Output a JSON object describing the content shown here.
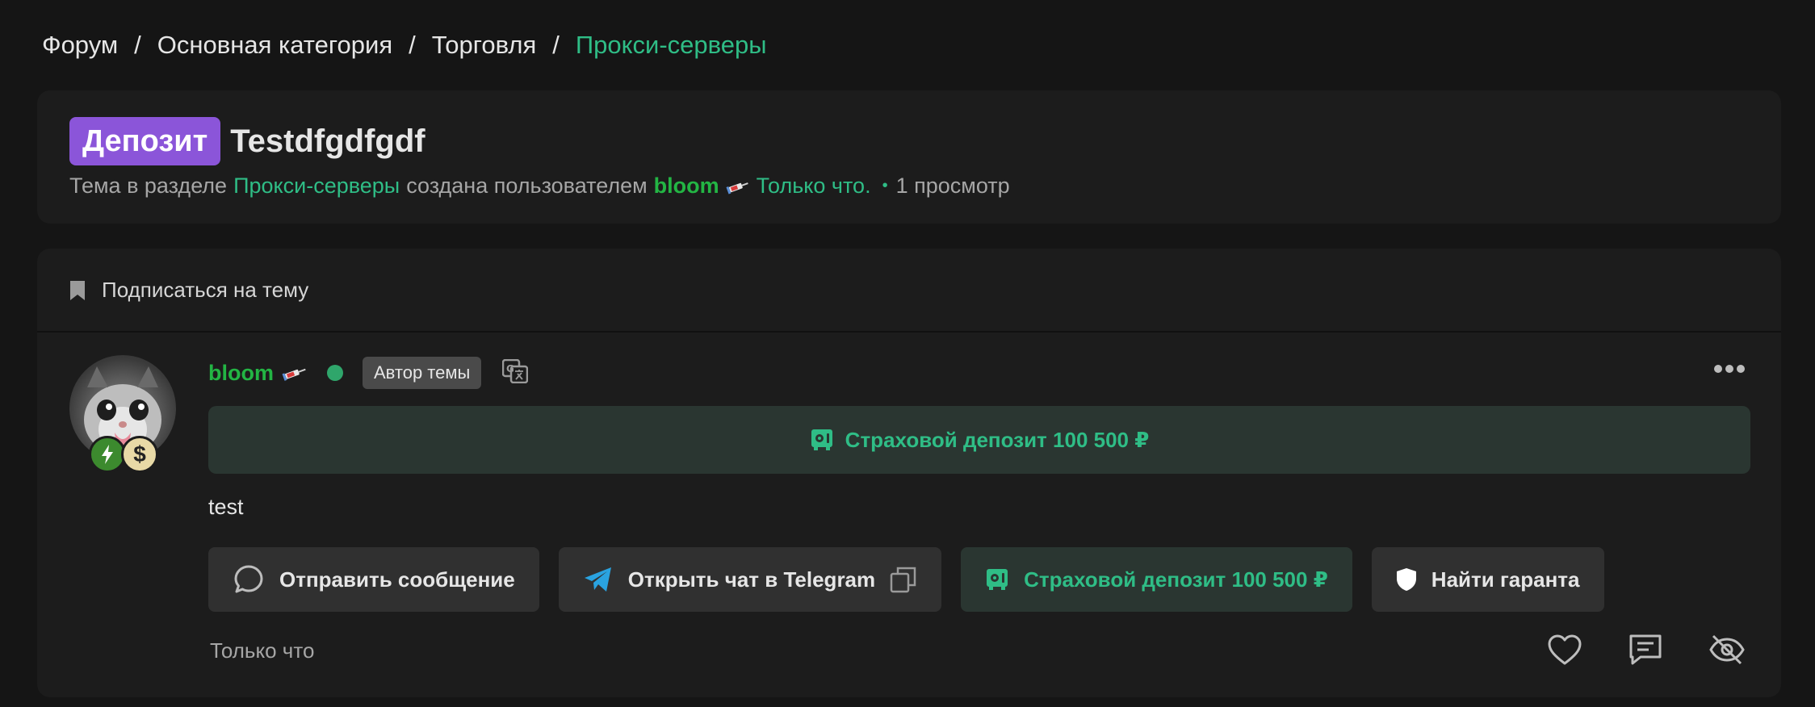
{
  "breadcrumb": {
    "items": [
      "Форум",
      "Основная категория",
      "Торговля",
      "Прокси-серверы"
    ],
    "separator": "/"
  },
  "thread": {
    "prefix": "Депозит",
    "title": "Testdfgdfgdf",
    "meta": {
      "in_section": "Тема в разделе",
      "section": "Прокси-серверы",
      "created_by": "создана пользователем",
      "username": "bloom",
      "time": "Только что.",
      "views": "1 просмотр"
    }
  },
  "post": {
    "subscribe_label": "Подписаться на тему",
    "author": "bloom",
    "author_tag": "Автор темы",
    "deposit_banner": "Страховой депозит 100 500 ₽",
    "body": "test",
    "actions": {
      "message": "Отправить сообщение",
      "telegram": "Открыть чат в Telegram",
      "deposit": "Страховой депозит 100 500 ₽",
      "guarantor": "Найти гаранта"
    },
    "time": "Только что"
  },
  "colors": {
    "accent": "#2fbd86",
    "username": "#23b544",
    "prefix": "#8b55d9",
    "background": "#151515",
    "card": "#1c1c1c"
  },
  "icons": [
    "bookmark-icon",
    "syringe-icon",
    "translate-icon",
    "more-icon",
    "safe-icon",
    "chat-bubble-icon",
    "telegram-icon",
    "copy-icon",
    "shield-icon",
    "heart-icon",
    "reply-icon",
    "hide-icon",
    "bolt-icon",
    "dollar-icon"
  ]
}
